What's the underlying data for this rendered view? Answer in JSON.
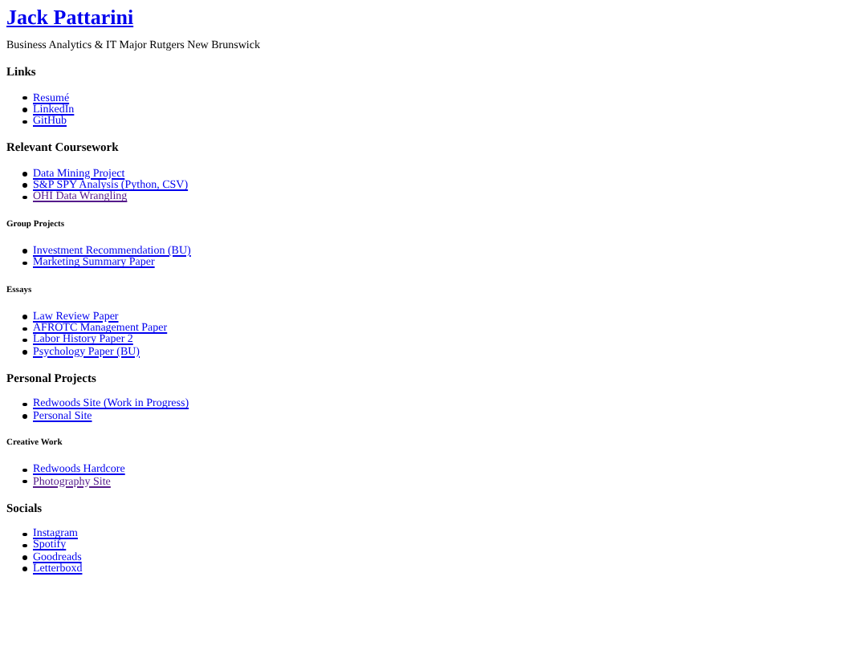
{
  "title": "Jack Pattarini",
  "subtitle": "Business Analytics & IT Major Rutgers New Brunswick",
  "sections": [
    {
      "heading": "Links",
      "kind": "major",
      "links": [
        {
          "label": "Resumé",
          "visited": false
        },
        {
          "label": "LinkedIn",
          "visited": false
        },
        {
          "label": "GitHub",
          "visited": false
        }
      ]
    },
    {
      "heading": "Relevant Coursework",
      "kind": "major",
      "links": [
        {
          "label": "Data Mining Project",
          "visited": false
        },
        {
          "label": "S&P SPY Analysis (Python, CSV)",
          "visited": false
        },
        {
          "label": "OHI Data Wrangling",
          "visited": true
        }
      ]
    },
    {
      "heading": "Group Projects",
      "kind": "minor",
      "links": [
        {
          "label": "Investment Recommendation (BU)",
          "visited": false
        },
        {
          "label": "Marketing Summary Paper",
          "visited": false
        }
      ]
    },
    {
      "heading": "Essays",
      "kind": "minor",
      "links": [
        {
          "label": "Law Review Paper",
          "visited": false
        },
        {
          "label": "AFROTC Management Paper",
          "visited": false
        },
        {
          "label": "Labor History Paper 2",
          "visited": false
        },
        {
          "label": "Psychology Paper (BU)",
          "visited": false
        }
      ]
    },
    {
      "heading": "Personal Projects",
      "kind": "major",
      "links": [
        {
          "label": "Redwoods Site (Work in Progress)",
          "visited": false
        },
        {
          "label": "Personal Site",
          "visited": false
        }
      ]
    },
    {
      "heading": "Creative Work",
      "kind": "minor",
      "links": [
        {
          "label": "Redwoods Hardcore",
          "visited": false
        },
        {
          "label": "Photography Site",
          "visited": true
        }
      ]
    },
    {
      "heading": "Socials",
      "kind": "major",
      "links": [
        {
          "label": "Instagram",
          "visited": false
        },
        {
          "label": "Spotify",
          "visited": false
        },
        {
          "label": "Goodreads",
          "visited": false
        },
        {
          "label": "Letterboxd",
          "visited": false
        }
      ]
    }
  ]
}
